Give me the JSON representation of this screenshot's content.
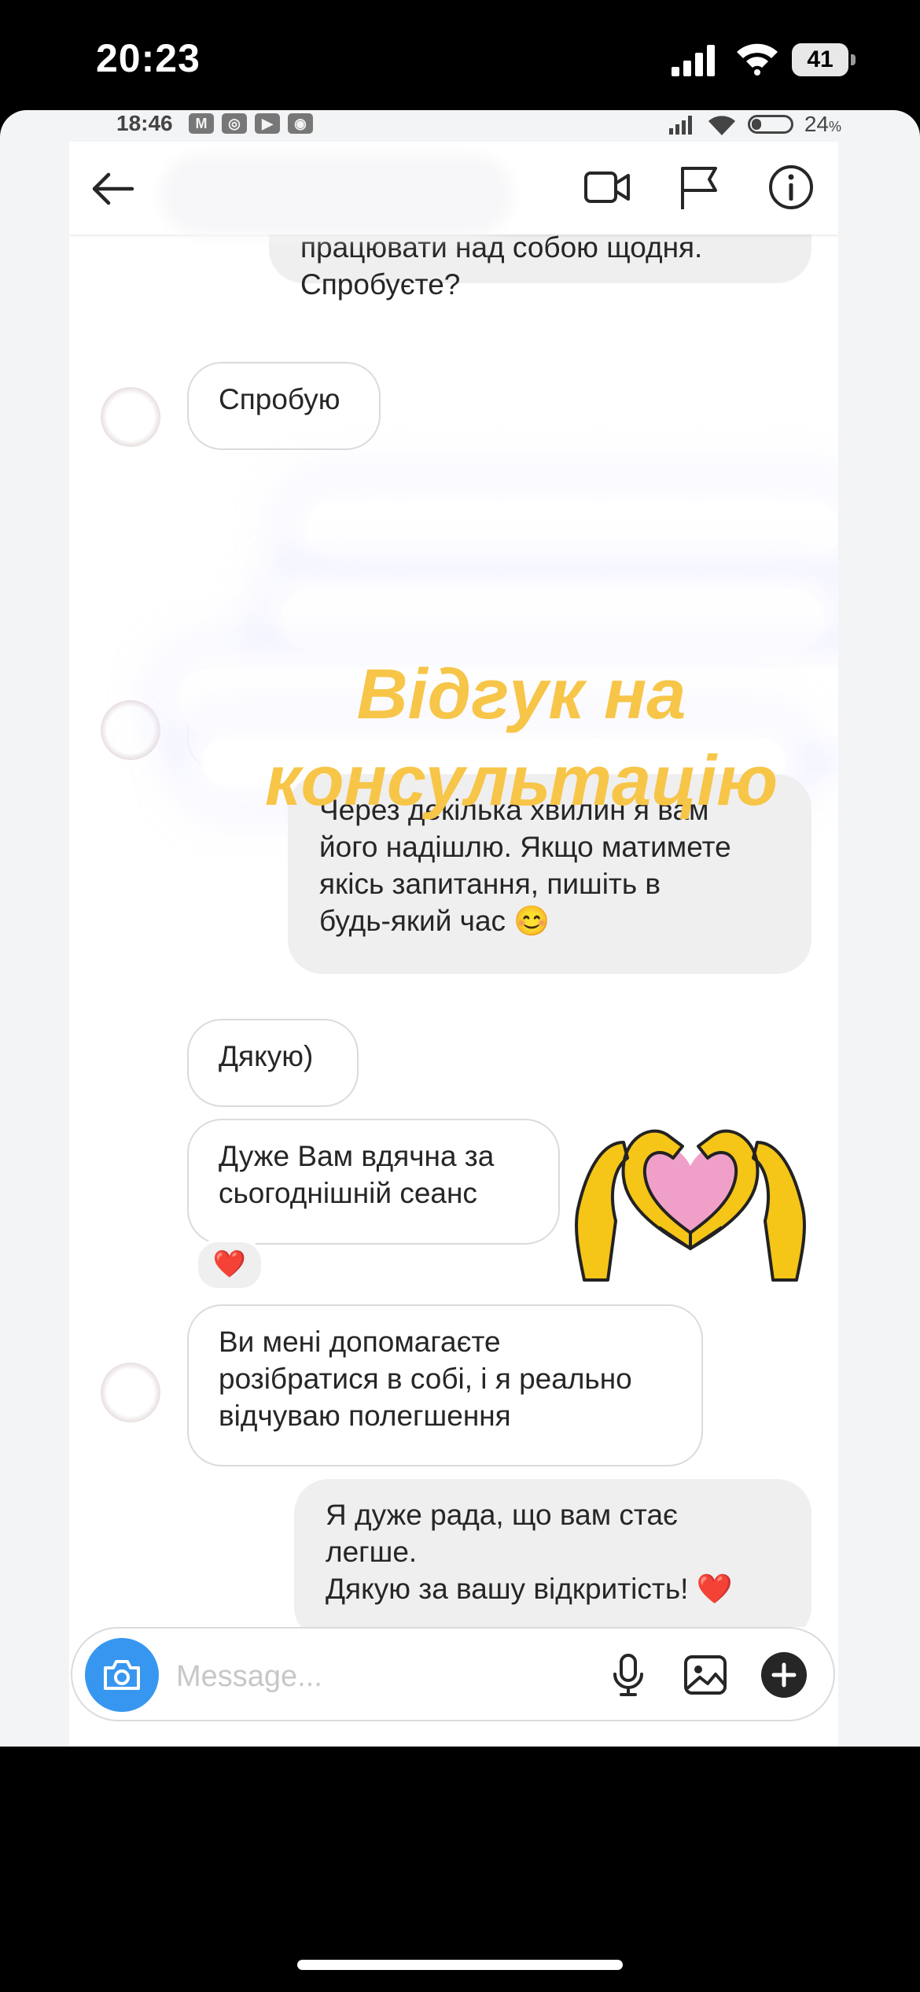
{
  "ios_status": {
    "time": "20:23",
    "battery": "41"
  },
  "android_status": {
    "time": "18:46",
    "battery": "24",
    "battery_unit": "%"
  },
  "header": {
    "icons": [
      "back-arrow-icon",
      "video-call-icon",
      "flag-icon",
      "info-icon"
    ]
  },
  "overlay": {
    "title": "Відгук на\nконсультацію",
    "color": "#f7c548"
  },
  "messages": [
    {
      "side": "out",
      "text": "не буду. Це для тих, хто хоче\nпрацювати над собою щодня.\nСпробуєте?"
    },
    {
      "side": "in",
      "text": "Спробую"
    },
    {
      "side": "out",
      "text": "Через декілька хвилин я вам\nйого надішлю. Якщо матимете\nякісь запитання, пишіть в\nбудь-який час 😊"
    },
    {
      "side": "in",
      "text": "Дякую)"
    },
    {
      "side": "in",
      "text": "Дуже Вам вдячна за\nсьогоднішній сеанс",
      "reaction": "❤️"
    },
    {
      "side": "in",
      "text": "Ви мені допомагаєте\nрозібратися в собі, і я реально\nвідчуваю полегшення"
    },
    {
      "side": "out",
      "text": "Я дуже рада, що вам стає\nлегше.\nДякую за вашу відкритість! ❤️"
    }
  ],
  "composer": {
    "placeholder": "Message...",
    "icons": [
      "camera-icon",
      "microphone-icon",
      "gallery-icon",
      "plus-icon"
    ]
  },
  "colors": {
    "accent": "#3797f0",
    "out_bubble": "#efefef",
    "heart": "#d62232",
    "hands": "#f5c518",
    "heart_fill": "#f0a0c8"
  }
}
